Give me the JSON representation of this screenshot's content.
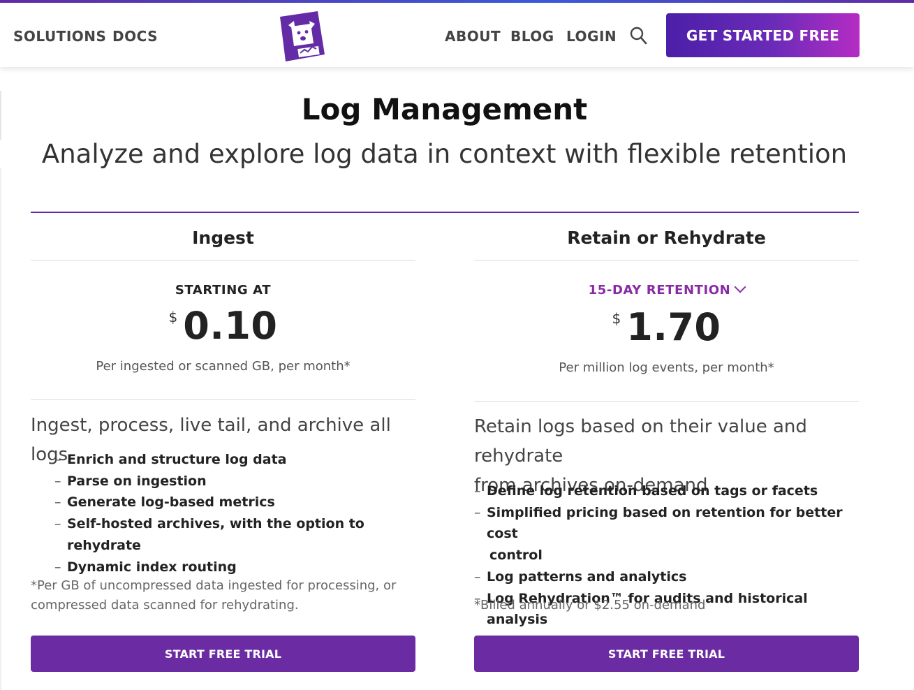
{
  "colors": {
    "brand_purple": "#632ca6",
    "button_purple": "#6a2ba3",
    "retention_purple": "#8a2aa6",
    "cta_gradient_start": "#4b1fa8",
    "cta_gradient_end": "#b52cc4"
  },
  "nav": {
    "left_links": [
      "SOLUTIONS",
      "DOCS"
    ],
    "right_links": [
      "ABOUT",
      "BLOG",
      "LOGIN"
    ],
    "search_icon": "search-icon",
    "logo_icon": "dog-logo-icon",
    "cta_label": "GET STARTED FREE"
  },
  "header": {
    "title": "Log Management",
    "subtitle": "Analyze and explore log data in context with flexible retention"
  },
  "columns": [
    {
      "heading": "Ingest",
      "price_label": "STARTING AT",
      "currency": "$",
      "amount": "0.10",
      "per_unit": "Per ingested or scanned GB, per month*",
      "description_lines": [
        "Ingest, process, live tail, and archive all logs"
      ],
      "features": [
        [
          "Enrich and structure log data"
        ],
        [
          "Parse on ingestion"
        ],
        [
          "Generate log-based metrics"
        ],
        [
          "Self-hosted archives, with the option to rehydrate"
        ],
        [
          "Dynamic index routing"
        ]
      ],
      "footnote_lines": [
        "*Per GB of uncompressed data ingested for processing, or",
        "compressed data scanned for rehydrating."
      ],
      "button_label": "START FREE TRIAL"
    },
    {
      "heading": "Retain or Rehydrate",
      "price_label": "15-DAY RETENTION",
      "currency": "$",
      "amount": "1.70",
      "per_unit": "Per million log events, per month*",
      "description_lines": [
        "Retain logs based on their value and rehydrate",
        "from archives on-demand"
      ],
      "features": [
        [
          "Define log retention based on tags or facets"
        ],
        [
          "Simplified pricing based on retention for better cost",
          "control"
        ],
        [
          "Log patterns and analytics"
        ],
        [
          "Log Rehydration™ for audits and historical analysis"
        ]
      ],
      "footnote_lines": [
        "*Billed annually or $2.55 on-demand"
      ],
      "button_label": "START FREE TRIAL"
    }
  ]
}
